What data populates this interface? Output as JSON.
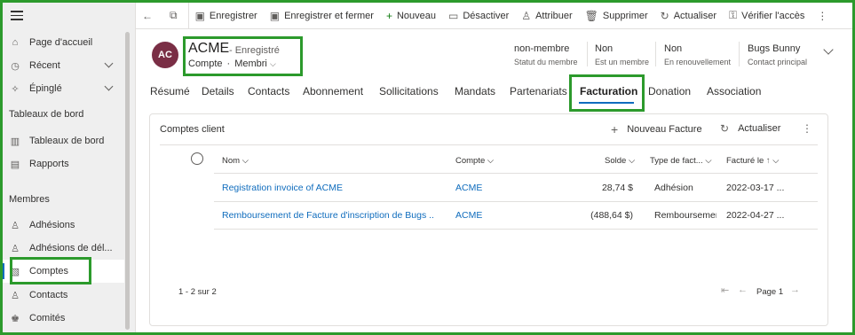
{
  "sidebar": {
    "items": [
      {
        "label": "Page d'accueil",
        "icon": "home-icon"
      },
      {
        "label": "Récent",
        "icon": "clock-icon"
      },
      {
        "label": "Épinglé",
        "icon": "pin-icon"
      }
    ],
    "section_dashboards": "Tableaux de bord",
    "dashboards": [
      {
        "label": "Tableaux de bord",
        "icon": "dashboard-icon"
      },
      {
        "label": "Rapports",
        "icon": "report-icon"
      }
    ],
    "section_members": "Membres",
    "members": [
      {
        "label": "Adhésions",
        "icon": "membership-icon"
      },
      {
        "label": "Adhésions de dél...",
        "icon": "membership-icon"
      },
      {
        "label": "Comptes",
        "icon": "account-icon"
      },
      {
        "label": "Contacts",
        "icon": "contact-icon"
      },
      {
        "label": "Comités",
        "icon": "committee-icon"
      }
    ]
  },
  "commands": {
    "save": "Enregistrer",
    "save_close": "Enregistrer et fermer",
    "new": "Nouveau",
    "deactivate": "Désactiver",
    "assign": "Attribuer",
    "delete": "Supprimer",
    "refresh": "Actualiser",
    "check_access": "Vérifier l'accès"
  },
  "record": {
    "initials": "AC",
    "title": "ACME",
    "status": "- Enregistré",
    "entity": "Compte",
    "dot": "·",
    "form": "Membri"
  },
  "header_fields": [
    {
      "value": "non-membre",
      "label": "Statut du membre"
    },
    {
      "value": "Non",
      "label": "Est un membre"
    },
    {
      "value": "Non",
      "label": "En renouvellement"
    },
    {
      "value": "Bugs Bunny",
      "label": "Contact principal"
    }
  ],
  "tabs": [
    "Résumé",
    "Details",
    "Contacts",
    "Abonnement",
    "Sollicitations",
    "Mandats",
    "Partenariats",
    "Facturation",
    "Donation",
    "Association"
  ],
  "active_tab": "Facturation",
  "grid": {
    "title": "Comptes client",
    "new_label": "Nouveau Facture",
    "refresh_label": "Actualiser",
    "columns": [
      "Nom",
      "Compte",
      "Solde",
      "Type de fact...",
      "Facturé le"
    ],
    "rows": [
      {
        "name": "Registration invoice of ACME",
        "account": "ACME",
        "balance": "28,74 $",
        "type": "Adhésion",
        "date": "2022-03-17 ..."
      },
      {
        "name": "Remboursement de Facture d'inscription de Bugs ...",
        "account": "ACME",
        "balance": "(488,64 $)",
        "type": "Remboursemer",
        "date": "2022-04-27 ..."
      }
    ],
    "count": "1 - 2 sur 2",
    "page": "Page 1"
  },
  "colors": {
    "accent": "#0f6cbd",
    "highlight": "#2c9a2c",
    "avatar": "#7a2e45"
  }
}
